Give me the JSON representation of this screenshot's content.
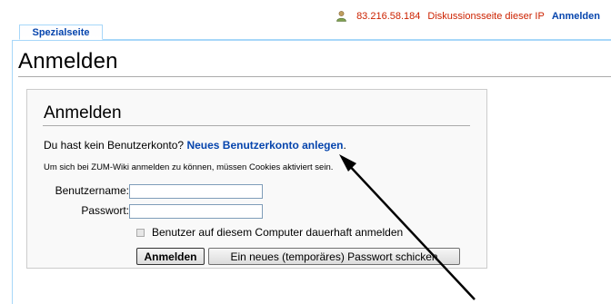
{
  "personal": {
    "ip": "83.216.58.184",
    "talk": "Diskussionsseite dieser IP",
    "login": "Anmelden"
  },
  "tabs": [
    {
      "label": "Spezialseite"
    }
  ],
  "page": {
    "title": "Anmelden"
  },
  "login_form": {
    "title": "Anmelden",
    "no_account_text": "Du hast kein Benutzerkonto? ",
    "create_account_link": "Neues Benutzerkonto anlegen",
    "create_account_suffix": ".",
    "cookie_note": "Um sich bei ZUM-Wiki anmelden zu können, müssen Cookies aktiviert sein.",
    "username_label": "Benutzername:",
    "username_value": "",
    "password_label": "Passwort:",
    "password_value": "",
    "remember_label": "Benutzer auf diesem Computer dauerhaft anmelden",
    "login_button": "Anmelden",
    "mail_password_button": "Ein neues (temporäres) Passwort schicken"
  },
  "icons": {
    "user": "user-icon",
    "arrow": "annotation-arrow"
  },
  "colors": {
    "link": "#0645ad",
    "new_link": "#cc2200",
    "tab_border": "#a7d7f9"
  }
}
